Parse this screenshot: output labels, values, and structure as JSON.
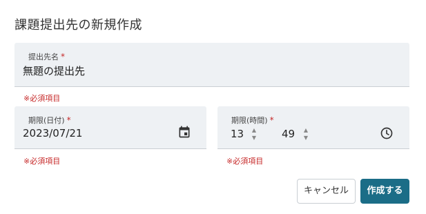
{
  "dialog": {
    "title": "課題提出先の新規作成"
  },
  "fields": {
    "name": {
      "label": "提出先名",
      "required_mark": "*",
      "value": "無題の提出先",
      "helper": "※必須項目"
    },
    "due_date": {
      "label": "期限(日付)",
      "required_mark": "*",
      "value": "2023/07/21",
      "helper": "※必須項目"
    },
    "due_time": {
      "label": "期限(時間)",
      "required_mark": "*",
      "hour": "13",
      "minute": "49",
      "helper": "※必須項目"
    }
  },
  "icons": {
    "date": "calendar-icon",
    "time": "clock-icon"
  },
  "buttons": {
    "cancel": "キャンセル",
    "create": "作成する"
  },
  "colors": {
    "field_bg": "#eef1f4",
    "error": "#c62828",
    "primary": "#1b6d87"
  }
}
